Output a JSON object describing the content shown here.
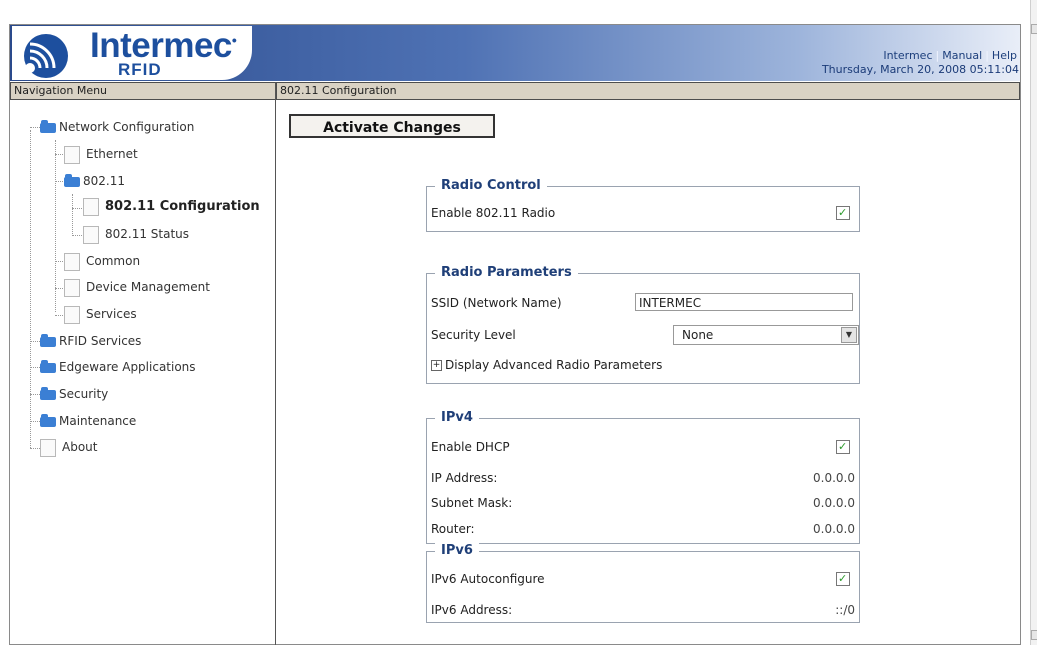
{
  "brand": {
    "name": "Intermec",
    "reg": "•",
    "sub": "RFID"
  },
  "toplinks": {
    "intermec": "Intermec",
    "manual": "Manual",
    "help": "Help",
    "sep": "|"
  },
  "datetime": "Thursday, March 20, 2008 05:11:04",
  "nav_title": "Navigation Menu",
  "main_title": "802.11 Configuration",
  "tree": {
    "network_configuration": "Network Configuration",
    "ethernet": "Ethernet",
    "n80211": "802.11",
    "n80211_config": "802.11 Configuration",
    "n80211_status": "802.11 Status",
    "common": "Common",
    "device_management": "Device Management",
    "services": "Services",
    "rfid_services": "RFID Services",
    "edgeware_applications": "Edgeware Applications",
    "security": "Security",
    "maintenance": "Maintenance",
    "about": "About"
  },
  "activate_label": "Activate Changes",
  "radio_control": {
    "legend": "Radio Control",
    "enable_label": "Enable 802.11 Radio",
    "enabled": true
  },
  "radio_parameters": {
    "legend": "Radio Parameters",
    "ssid_label": "SSID (Network Name)",
    "ssid_value": "INTERMEC",
    "security_label": "Security Level",
    "security_value": "None",
    "advanced_link": "Display Advanced Radio Parameters"
  },
  "ipv4": {
    "legend": "IPv4",
    "dhcp_label": "Enable DHCP",
    "dhcp_enabled": true,
    "ip_label": "IP Address:",
    "ip_value": "0.0.0.0",
    "subnet_label": "Subnet Mask:",
    "subnet_value": "0.0.0.0",
    "router_label": "Router:",
    "router_value": "0.0.0.0"
  },
  "ipv6": {
    "legend": "IPv6",
    "auto_label": "IPv6 Autoconfigure",
    "auto_enabled": true,
    "addr_label": "IPv6 Address:",
    "addr_value": "::/0"
  },
  "colors": {
    "header_dark": "#2a4a8c",
    "brand_blue": "#1d4f9e",
    "titlebar": "#d9d2c4",
    "legend": "#1f3f78"
  }
}
